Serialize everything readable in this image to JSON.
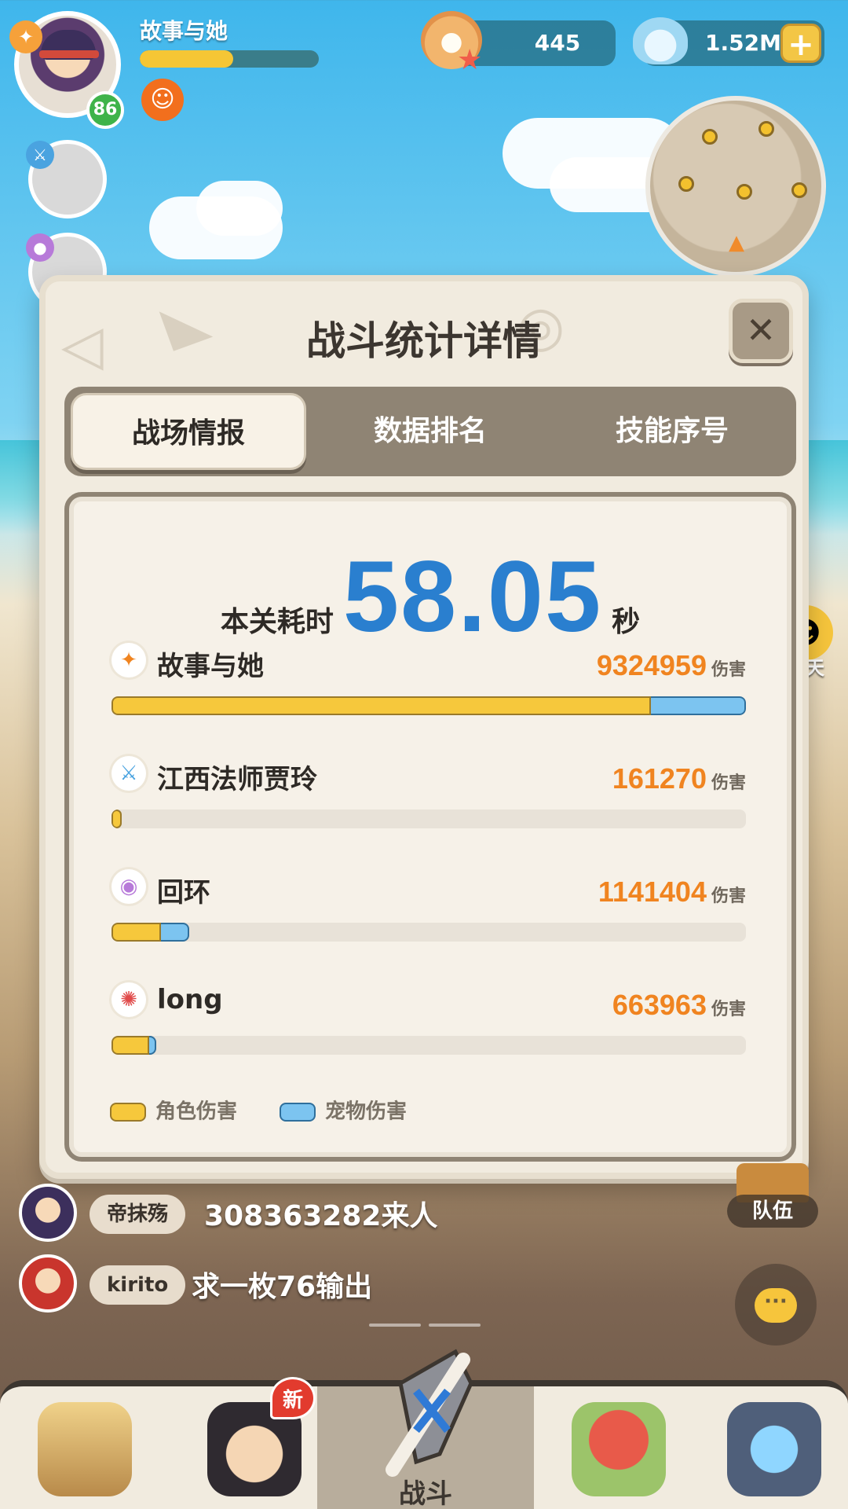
{
  "hud": {
    "player_name": "故事与她",
    "level": "86",
    "exp_progress": 0.52,
    "pearl_amount": "445",
    "shell_amount": "1.52M"
  },
  "chat_side_label": "聊天",
  "team_label": "队伍",
  "modal": {
    "title": "战斗统计详情",
    "tabs": [
      {
        "label": "战场情报",
        "active": true
      },
      {
        "label": "数据排名",
        "active": false
      },
      {
        "label": "技能序号",
        "active": false
      }
    ],
    "time_label": "本关耗时",
    "time_value": "58.05",
    "time_unit": "秒",
    "damage_unit": "伤害",
    "rows": [
      {
        "name": "故事与她",
        "damage": "9324959",
        "icon": "flame-claw-icon",
        "icon_color": "#f08420",
        "hero_fraction": 0.85,
        "pet_fraction": 0.15
      },
      {
        "name": "江西法师贾玲",
        "damage": "161270",
        "icon": "blue-sword-icon",
        "icon_color": "#4aa3e0",
        "hero_fraction": 0.016,
        "pet_fraction": 0.0
      },
      {
        "name": "回环",
        "damage": "1141404",
        "icon": "purple-orb-icon",
        "icon_color": "#b77ad9",
        "hero_fraction": 0.078,
        "pet_fraction": 0.044
      },
      {
        "name": "long",
        "damage": "663963",
        "icon": "red-swirl-icon",
        "icon_color": "#e04a4a",
        "hero_fraction": 0.06,
        "pet_fraction": 0.011
      }
    ],
    "legend": [
      {
        "label": "角色伤害",
        "color": "#f6c83c"
      },
      {
        "label": "宠物伤害",
        "color": "#7cc4f0"
      }
    ]
  },
  "chat": [
    {
      "user": "帝抹殇",
      "text": "308363282来人"
    },
    {
      "user": "kirito",
      "text": "求一枚76输出"
    }
  ],
  "bottom_nav": {
    "new_badge": "新",
    "items": [
      {
        "label": "",
        "name": "nav-character"
      },
      {
        "label": "",
        "name": "nav-hero"
      },
      {
        "label": "战斗",
        "name": "nav-battle"
      },
      {
        "label": "",
        "name": "nav-pet"
      },
      {
        "label": "",
        "name": "nav-portal"
      }
    ]
  },
  "colors": {
    "hero_damage": "#f6c83c",
    "pet_damage": "#7cc4f0",
    "damage_value": "#f08420",
    "time_value": "#2a7fcf"
  }
}
